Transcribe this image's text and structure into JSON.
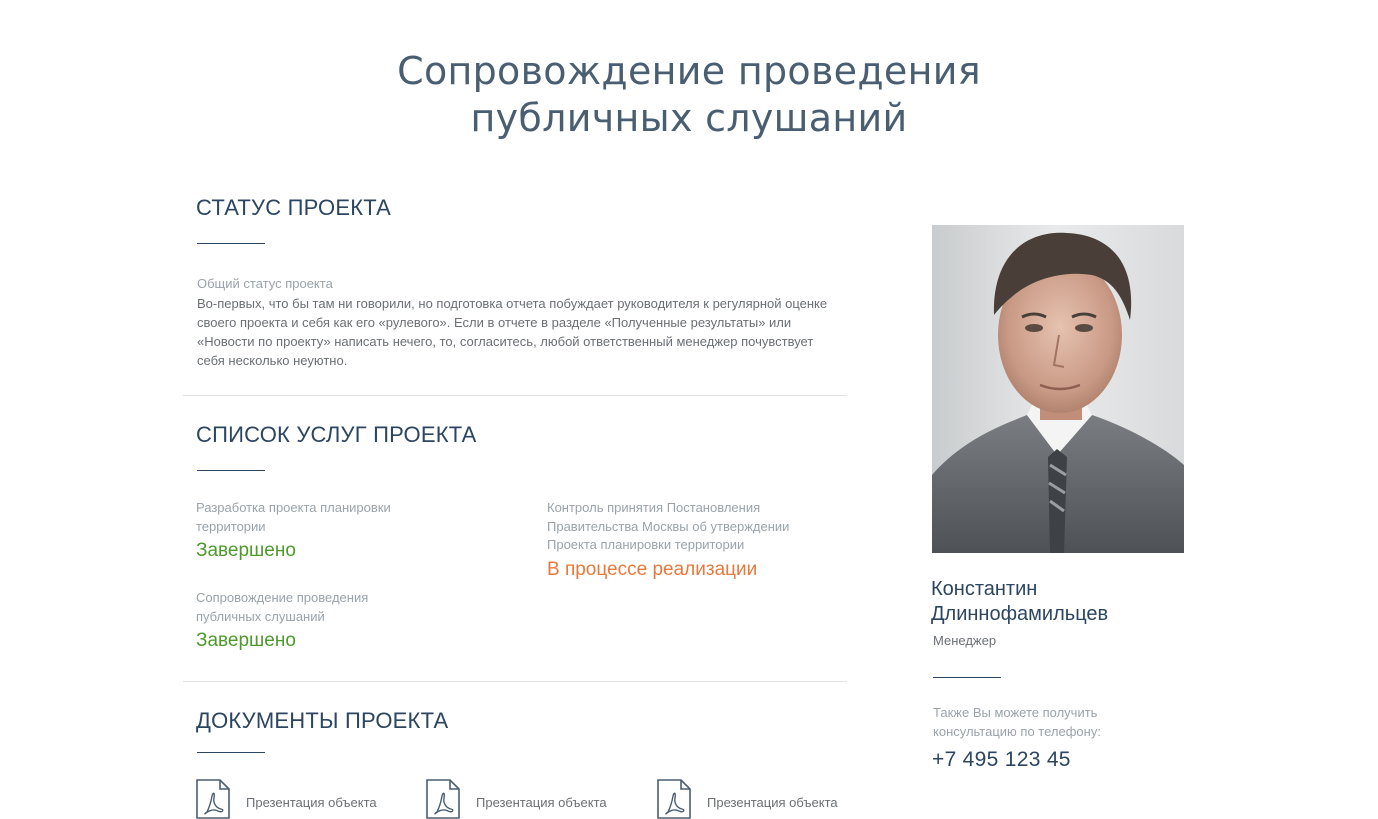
{
  "page": {
    "title_line1": "Сопровождение проведения",
    "title_line2": "публичных слушаний"
  },
  "status": {
    "heading": "СТАТУС ПРОЕКТА",
    "label": "Общий статус проекта",
    "text": "Во-первых, что бы там ни говорили, но подготовка отчета побуждает руководителя к регулярной оценке своего проекта и себя как его «рулевого». Если в отчете в разделе «Полученные результаты» или «Новости по проекту» написать нечего, то, согласитесь, любой ответственный менеджер почувствует себя несколько неуютно."
  },
  "services": {
    "heading": "СПИСОК УСЛУГ ПРОЕКТА",
    "items": [
      {
        "name": "Разработка проекта планировки территории",
        "state": "Завершено",
        "state_color": "#4d9a2a"
      },
      {
        "name": "Контроль принятия Постановления Правительства Москвы об утверждении Проекта планировки территории",
        "state": "В процессе реализации",
        "state_color": "#e8793c"
      },
      {
        "name": "Сопровождение проведения публичных слушаний",
        "state": "Завершено",
        "state_color": "#4d9a2a"
      }
    ]
  },
  "documents": {
    "heading": "ДОКУМЕНТЫ ПРОЕКТА",
    "items": [
      {
        "label": "Презентация объекта",
        "icon": "pdf-icon"
      },
      {
        "label": "Презентация объекта",
        "icon": "pdf-icon"
      },
      {
        "label": "Презентация объекта",
        "icon": "pdf-icon"
      }
    ]
  },
  "manager": {
    "first_name": "Константин",
    "last_name": "Длиннофамильцев",
    "role": "Менеджер",
    "consult_text": "Также Вы можете получить консультацию по телефону:",
    "phone": "+7 495 123 45"
  },
  "colors": {
    "heading": "#2c4560",
    "done": "#4d9a2a",
    "in_progress": "#e8793c",
    "muted": "#9aa3ab"
  }
}
